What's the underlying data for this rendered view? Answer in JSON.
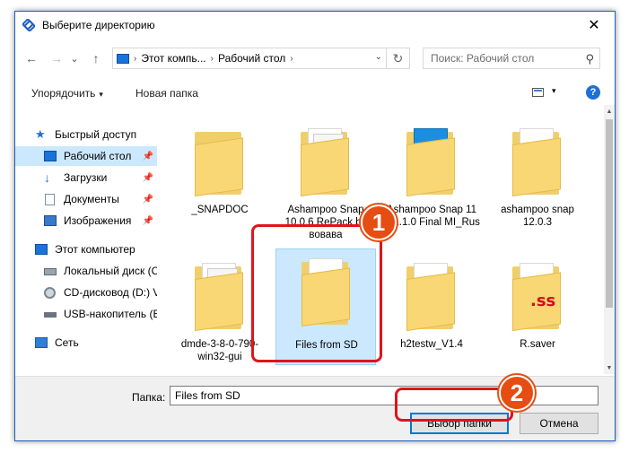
{
  "window": {
    "title": "Выберите директорию",
    "close_glyph": "✕"
  },
  "nav": {
    "back_glyph": "←",
    "forward_glyph": "→",
    "history_glyph": "⌄",
    "up_glyph": "↑",
    "breadcrumbs": [
      "Этот компь...",
      "Рабочий стол"
    ],
    "crumb_sep": "›",
    "dropdown_glyph": "⌄",
    "refresh_glyph": "↻",
    "search_placeholder": "Поиск: Рабочий стол",
    "search_glyph": "⚲"
  },
  "toolbar": {
    "organize_label": "Упорядочить",
    "organize_caret": "▾",
    "new_folder_label": "Новая папка",
    "view_caret": "▾",
    "help_label": "?"
  },
  "sidebar": {
    "pin_glyph": "📌",
    "items": [
      {
        "label": "Быстрый доступ",
        "icon": "star-icon"
      },
      {
        "label": "Рабочий стол",
        "icon": "desktop-icon",
        "pinned": true,
        "selected": true
      },
      {
        "label": "Загрузки",
        "icon": "download-icon",
        "pinned": true
      },
      {
        "label": "Документы",
        "icon": "documents-icon",
        "pinned": true
      },
      {
        "label": "Изображения",
        "icon": "pictures-icon",
        "pinned": true
      },
      {
        "label": "Этот компьютер",
        "icon": "computer-icon"
      },
      {
        "label": "Локальный диск (C",
        "icon": "drive-icon"
      },
      {
        "label": "CD-дисковод (D:) V",
        "icon": "cd-icon"
      },
      {
        "label": "USB-накопитель (E",
        "icon": "usb-icon"
      },
      {
        "label": "Сеть",
        "icon": "network-icon"
      }
    ]
  },
  "folders": [
    {
      "name": "_SNAPDOC",
      "icon": "folder-icon"
    },
    {
      "name": "Ashampoo Snap 10.0.6 RePack by вовава",
      "icon": "folder-icon"
    },
    {
      "name": "Ashampoo Snap 11 v11.1.0 Final MI_Rus",
      "icon": "folder-icon"
    },
    {
      "name": "ashampoo snap 12.0.3",
      "icon": "folder-icon"
    },
    {
      "name": "dmde-3-8-0-790-win32-gui",
      "icon": "folder-icon"
    },
    {
      "name": "Files from SD",
      "icon": "folder-icon",
      "selected": true
    },
    {
      "name": "h2testw_V1.4",
      "icon": "folder-icon"
    },
    {
      "name": "R.saver",
      "icon": "folder-icon"
    }
  ],
  "scrollbar": {
    "up_glyph": "▲",
    "down_glyph": "▼"
  },
  "footer": {
    "folder_label": "Папка:",
    "folder_value": "Files from SD",
    "select_label": "Выбор папки",
    "cancel_label": "Отмена"
  },
  "annotations": [
    {
      "number": "1"
    },
    {
      "number": "2"
    }
  ],
  "colors": {
    "accent": "#0078d7",
    "selection": "#cce8ff",
    "folder": "#f8d774",
    "highlight": "#e0131b",
    "badge": "#e54d12"
  }
}
